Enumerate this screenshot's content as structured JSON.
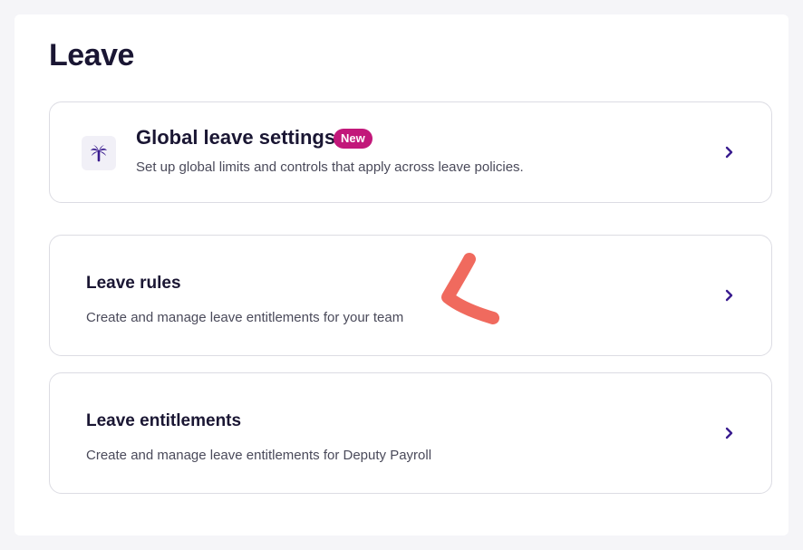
{
  "page": {
    "title": "Leave"
  },
  "cards": [
    {
      "title": "Global leave settings",
      "badge": "New",
      "description": "Set up global limits and controls that apply across leave policies.",
      "icon": "palm-tree-icon"
    },
    {
      "title": "Leave rules",
      "description": "Create and manage leave entitlements for your team"
    },
    {
      "title": "Leave entitlements",
      "description": "Create and manage leave entitlements for Deputy Payroll"
    }
  ],
  "colors": {
    "accent": "#3a1c8f",
    "badge": "#c2187a",
    "annotation": "#f06a5e"
  }
}
